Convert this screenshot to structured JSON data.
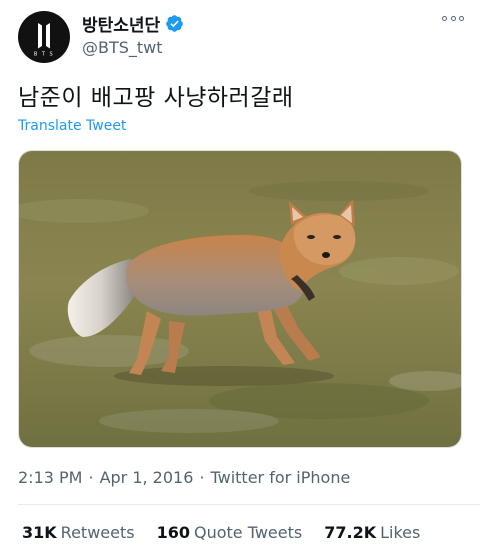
{
  "author": {
    "display_name": "방탄소년단",
    "handle": "@BTS_twt",
    "verified": true,
    "avatar_logo_text": "BTS"
  },
  "tweet": {
    "text": "남준이 배고팡 사냥하러갈래",
    "translate_label": "Translate Tweet"
  },
  "meta": {
    "time": "2:13 PM",
    "separator": "·",
    "date": "Apr 1, 2016",
    "source": "Twitter for iPhone"
  },
  "stats": {
    "retweets_count": "31K",
    "retweets_label": "Retweets",
    "quotes_count": "160",
    "quotes_label": "Quote Tweets",
    "likes_count": "77.2K",
    "likes_label": "Likes"
  },
  "colors": {
    "link": "#1d9bf0",
    "secondary_text": "#536471",
    "verified_badge": "#1d9bf0"
  },
  "icons": {
    "more": "more-options-icon",
    "verified": "verified-badge-icon"
  }
}
